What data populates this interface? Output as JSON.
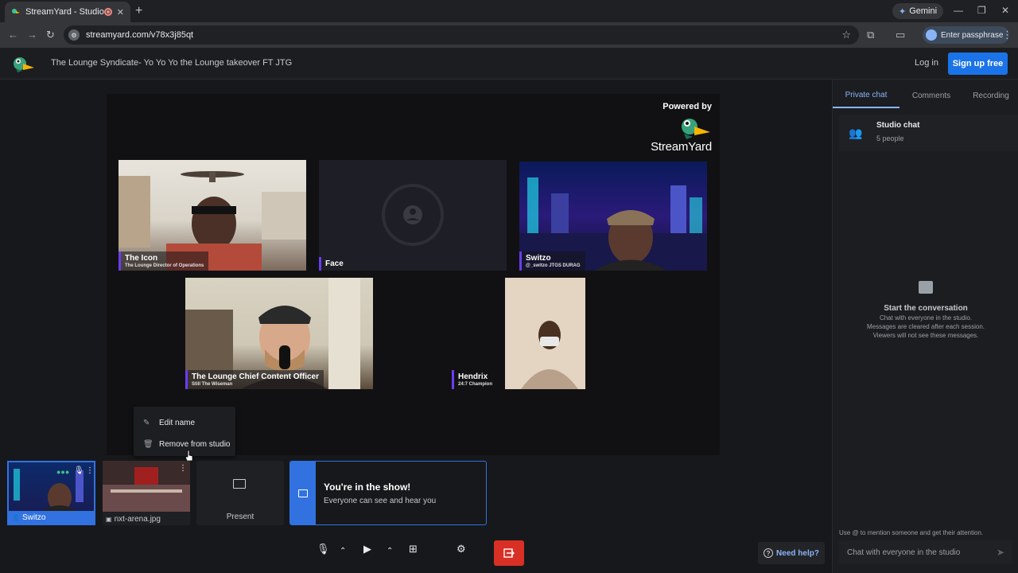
{
  "browser": {
    "tab_title": "StreamYard - Studio",
    "new_tab": "+",
    "gemini_label": "Gemini",
    "url": "streamyard.com/v78x3j85qt",
    "passphrase_label": "Enter passphrase"
  },
  "header": {
    "broadcast_title": "The Lounge Syndicate- Yo Yo Yo the Lounge takeover FT JTG",
    "login_label": "Log in",
    "signup_label": "Sign up free"
  },
  "stage": {
    "powered_by": "Powered by",
    "brand_name": "StreamYard",
    "tiles": [
      {
        "name": "The Icon",
        "subtitle": "The Lounge Director of Operations"
      },
      {
        "name": "Face",
        "subtitle": ""
      },
      {
        "name": "Switzo",
        "subtitle": "@_switzo JTGS DURAG"
      },
      {
        "name": "The Lounge Chief Content Officer",
        "subtitle": "Still The Wiseman"
      },
      {
        "name": "Hendrix",
        "subtitle": "24:7 Champion"
      }
    ]
  },
  "context_menu": {
    "items": [
      {
        "label": "Edit name",
        "icon": "pencil-icon"
      },
      {
        "label": "Remove from studio",
        "icon": "trash-icon"
      }
    ]
  },
  "bottom": {
    "self_label": "Switzo",
    "media_label": "nxt-arena.jpg",
    "present_label": "Present",
    "in_show_title": "You're in the show!",
    "in_show_sub": "Everyone can see and hear you",
    "need_help": "Need help?"
  },
  "panel": {
    "tabs": [
      "Private chat",
      "Comments",
      "Recording"
    ],
    "studio_chat_title": "Studio chat",
    "studio_chat_sub": "5 people",
    "empty_title": "Start the conversation",
    "empty_lines": [
      "Chat with everyone in the studio.",
      "Messages are cleared after each session.",
      "Viewers will not see these messages."
    ],
    "hint": "Use @ to mention someone and get their attention.",
    "input_placeholder": "Chat with everyone in the studio"
  },
  "colors": {
    "accent_blue": "#1a73e8",
    "nameplate_purple": "#6a3df0",
    "leave_red": "#d93025"
  }
}
